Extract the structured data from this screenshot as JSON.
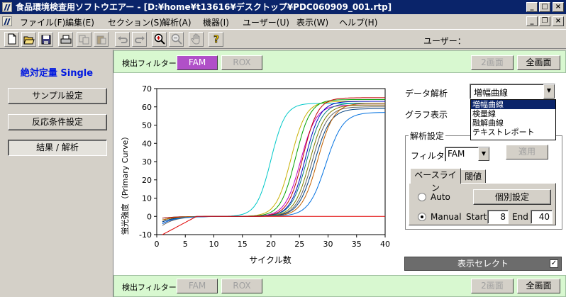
{
  "window": {
    "title": "食品環境検査用ソフトウエアー - [D:¥home¥t13616¥デスクトップ¥PDC060909_001.rtp]",
    "min_label": "_",
    "max_label": "□",
    "close_label": "×",
    "child_min": "_",
    "child_restore": "❐",
    "child_close": "×"
  },
  "menu": [
    "ファイル(F)",
    "編集(E)",
    "セクション(S)",
    "解析(A)",
    "機器(I)",
    "ユーザー(U)",
    "表示(W)",
    "ヘルプ(H)"
  ],
  "toolbar": {
    "user_label": "ユーザー：",
    "icons": [
      "new-icon",
      "open-icon",
      "save-icon",
      "print-icon",
      "copy-icon",
      "paste-icon",
      "undo-icon",
      "redo-icon",
      "zoom-in-icon",
      "zoom-out-icon",
      "hand-icon",
      "help-icon"
    ]
  },
  "left": {
    "mode_title": "絶対定量 Single",
    "nav": [
      "サンプル設定",
      "反応条件設定",
      "結果 / 解析"
    ]
  },
  "filter_top": {
    "label": "検出フィルター",
    "fam": "FAM",
    "rox": "ROX",
    "two_screen": "2画面",
    "full_screen": "全画面"
  },
  "filter_bottom": {
    "label": "検出フィルター",
    "fam": "FAM",
    "rox": "ROX",
    "two_screen": "2画面",
    "full_screen": "全画面"
  },
  "right": {
    "data_analysis_label": "データ解析",
    "data_analysis_value": "増幅曲線",
    "dropdown_options": [
      "増幅曲線",
      "検量線",
      "融解曲線",
      "テキストレポート"
    ],
    "graph_display_label": "グラフ表示",
    "analysis_settings_label": "解析設定",
    "filter_label": "フィルター",
    "filter_value": "FAM",
    "apply_button": "適用",
    "tab_baseline": "ベースライン",
    "tab_threshold": "閾値",
    "auto_label": "Auto",
    "individual_button": "個別設定",
    "manual_label": "Manual",
    "start_label": "Start",
    "start_value": "8",
    "end_label": "End",
    "end_value": "40",
    "display_select": "表示セレクト",
    "display_select_check": "✓"
  },
  "chart_data": {
    "type": "line",
    "ylabel": "蛍光強度（Primary Curve）",
    "xlabel": "サイクル数",
    "xlim": [
      0,
      40
    ],
    "ylim": [
      -10,
      70
    ],
    "xticks": [
      0,
      5,
      10,
      15,
      20,
      25,
      30,
      35,
      40
    ],
    "yticks": [
      -10,
      0,
      10,
      20,
      30,
      40,
      50,
      60,
      70
    ],
    "grid": false,
    "series": [
      {
        "color": "#00c8c8",
        "ct": 20.0,
        "plateau": 62,
        "slope": 1.25,
        "start": -1
      },
      {
        "color": "#c8b000",
        "ct": 23.5,
        "plateau": 63,
        "slope": 1.3,
        "start": -2
      },
      {
        "color": "#00a000",
        "ct": 24.3,
        "plateau": 64,
        "slope": 1.3,
        "start": -2
      },
      {
        "color": "#c000c0",
        "ct": 25.2,
        "plateau": 61,
        "slope": 1.35,
        "start": -3
      },
      {
        "color": "#c00000",
        "ct": 25.6,
        "plateau": 65,
        "slope": 1.3,
        "start": -1
      },
      {
        "color": "#0000c0",
        "ct": 26.0,
        "plateau": 63,
        "slope": 1.3,
        "start": -4
      },
      {
        "color": "#008080",
        "ct": 26.3,
        "plateau": 62,
        "slope": 1.35,
        "start": -3
      },
      {
        "color": "#808000",
        "ct": 26.8,
        "plateau": 61,
        "slope": 1.35,
        "start": -2
      },
      {
        "color": "#606060",
        "ct": 27.2,
        "plateau": 60,
        "slope": 1.35,
        "start": -5
      },
      {
        "color": "#004080",
        "ct": 27.6,
        "plateau": 59,
        "slope": 1.4,
        "start": -3
      },
      {
        "color": "#c06000",
        "ct": 28.2,
        "plateau": 62,
        "slope": 1.4,
        "start": -2
      },
      {
        "color": "#0070e0",
        "ct": 29.6,
        "plateau": 57,
        "slope": 1.5,
        "start": -4
      },
      {
        "color": "#e00000",
        "ct": 60.0,
        "plateau": 0,
        "slope": 1.0,
        "start": -10
      }
    ]
  }
}
